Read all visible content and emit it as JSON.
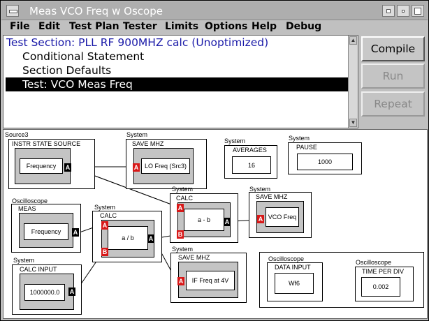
{
  "window": {
    "title": "Meas VCO Freq w Oscope"
  },
  "menu": [
    "File",
    "Edit",
    "Test Plan",
    "Tester",
    "Limits",
    "Options",
    "Help",
    "Debug"
  ],
  "tree": {
    "section": "Test Section: PLL RF 900MHZ calc (Unoptimized)",
    "items": [
      "Conditional Statement",
      "Section Defaults"
    ],
    "selected": "Test: VCO Meas Freq"
  },
  "buttons": {
    "compile": "Compile",
    "run": "Run",
    "repeat": "Repeat"
  },
  "pins": {
    "a": "A",
    "b": "B"
  },
  "blocks": {
    "source3": {
      "group": "Source3",
      "title": "INSTR STATE SOURCE",
      "value": "Frequency"
    },
    "save_lo": {
      "group": "System",
      "title": "SAVE MHZ",
      "value": "LO Freq (Src3)"
    },
    "averages": {
      "group": "System",
      "title": "AVERAGES",
      "value": "16"
    },
    "pause": {
      "group": "System",
      "title": "PAUSE",
      "value": "1000"
    },
    "calc_amb": {
      "group": "System",
      "title": "CALC",
      "value": "a - b"
    },
    "save_vco": {
      "group": "System",
      "title": "SAVE MHZ",
      "value": "VCO Freq"
    },
    "osc_meas": {
      "group": "Oscilloscope",
      "title": "MEAS",
      "value": "Frequency"
    },
    "calc_adb": {
      "group": "System",
      "title": "CALC",
      "value": "a / b"
    },
    "save_if": {
      "group": "System",
      "title": "SAVE MHZ",
      "value": "IF Freq at 4V"
    },
    "calc_input": {
      "group": "System",
      "title": "CALC INPUT",
      "value": "1000000.0"
    },
    "osc_data": {
      "group": "Oscilloscope",
      "title": "DATA INPUT",
      "value": "Wf6"
    },
    "osc_time": {
      "group": "Oscilloscope",
      "title": "TIME PER DIV",
      "value": "0.002"
    }
  }
}
